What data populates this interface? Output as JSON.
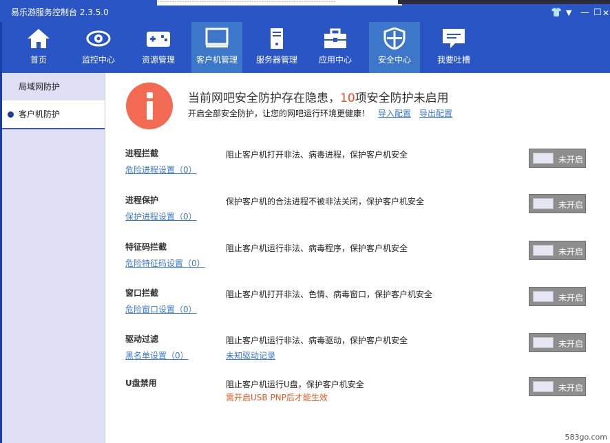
{
  "app": {
    "title": "易乐游服务控制台 2.3.5.0"
  },
  "title_bar": {
    "dashes": "------------------------------------------------------------------------"
  },
  "window_controls": {
    "shirt": "👕",
    "dropdown": "▼",
    "minimize": "—",
    "maximize": "☐",
    "close": "✕"
  },
  "nav": {
    "items": [
      {
        "label": "首页",
        "icon": "home-icon"
      },
      {
        "label": "监控中心",
        "icon": "eye-icon"
      },
      {
        "label": "资源管理",
        "icon": "gamepad-icon"
      },
      {
        "label": "客户机管理",
        "icon": "monitor-icon",
        "active": true
      },
      {
        "label": "服务器管理",
        "icon": "server-icon"
      },
      {
        "label": "应用中心",
        "icon": "toolbox-icon"
      },
      {
        "label": "安全中心",
        "icon": "shield-icon",
        "active": true
      },
      {
        "label": "我要吐槽",
        "icon": "chat-icon"
      }
    ]
  },
  "sidebar": {
    "items": [
      {
        "label": "局域网防护"
      },
      {
        "label": "客户机防护",
        "active": true
      }
    ]
  },
  "banner": {
    "prefix": "当前网吧安全防护存在隐患，",
    "count": "10",
    "suffix": "项安全防护未启用",
    "sub": "开启全部安全防护，让您的网吧运行环境更健康！",
    "import_link": "导入配置",
    "export_link": "导出配置"
  },
  "rules": [
    {
      "name": "进程拦截",
      "setting": "危险进程设置（0）",
      "desc": "阻止客户机打开非法、病毒进程，保护客户机安全",
      "extra": "",
      "toggle": "未开启"
    },
    {
      "name": "进程保护",
      "setting": "保护进程设置（0）",
      "desc": "保护客户机的合法进程不被非法关闭，保护客户机安全",
      "extra": "",
      "toggle": "未开启"
    },
    {
      "name": "特征码拦截",
      "setting": "危险特征码设置（0）",
      "desc": "阻止客户机运行非法、病毒程序，保护客户机安全",
      "extra": "",
      "toggle": "未开启"
    },
    {
      "name": "窗口拦截",
      "setting": "危险窗口设置（0）",
      "desc": "阻止客户机打开非法、色情、病毒窗口，保护客户机安全",
      "extra": "",
      "toggle": "未开启"
    },
    {
      "name": "驱动过滤",
      "setting": "黑名单设置（0）",
      "desc": "阻止客户机运行非法、病毒驱动，保护客户机安全",
      "extra": "未知驱动记录",
      "toggle": "未开启"
    },
    {
      "name": "U盘禁用",
      "setting": "",
      "desc": "阻止客户机运行U盘，保护客户机安全",
      "extra": "需开启USB PNP后才能生效",
      "toggle": "未开启"
    }
  ],
  "watermark": "583go.com",
  "colors": {
    "titlebar": "#2a55c4",
    "active_tab": "#3d77c9",
    "sidebar": "#dedef4",
    "link": "#3a78d0",
    "warn": "#e24a2a",
    "toggle_off": "#8e8e8e"
  }
}
